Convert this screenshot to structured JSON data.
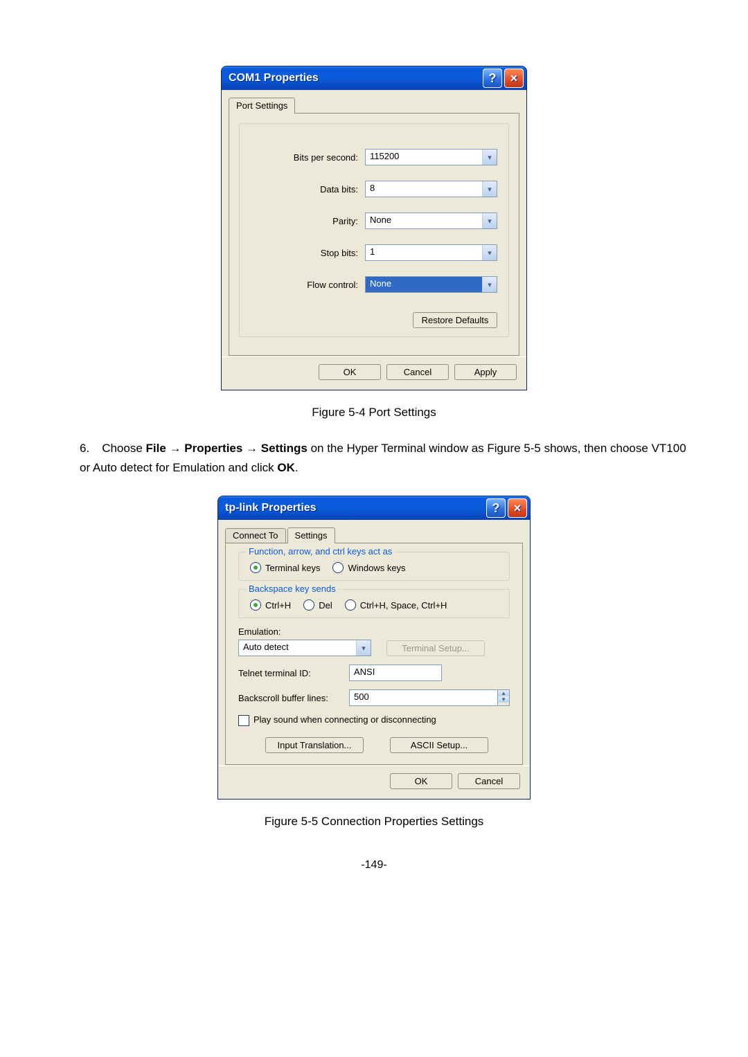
{
  "dialog1": {
    "title": "COM1 Properties",
    "tab": "Port Settings",
    "labels": {
      "bps": "Bits per second:",
      "data": "Data bits:",
      "parity": "Parity:",
      "stop": "Stop bits:",
      "flow": "Flow control:"
    },
    "values": {
      "bps": "115200",
      "data": "8",
      "parity": "None",
      "stop": "1",
      "flow": "None"
    },
    "restore": "Restore Defaults",
    "ok": "OK",
    "cancel": "Cancel",
    "apply": "Apply"
  },
  "fig1": "Figure 5-4 Port Settings",
  "body": {
    "num": "6.",
    "t1": "Choose ",
    "b1": "File → Properties → Settings",
    "t2": " on the Hyper Terminal window as Figure 5-5 shows, then choose VT100 or Auto detect for Emulation and click ",
    "b2": "OK",
    "t3": "."
  },
  "dialog2": {
    "title": "tp-link Properties",
    "tab_connect": "Connect To",
    "tab_settings": "Settings",
    "grp1": "Function, arrow, and ctrl keys act as",
    "r_terminal": "Terminal keys",
    "r_windows": "Windows keys",
    "grp2": "Backspace key sends",
    "r_ctrlh": "Ctrl+H",
    "r_del": "Del",
    "r_chsch": "Ctrl+H, Space, Ctrl+H",
    "emu_label": "Emulation:",
    "emu_value": "Auto detect",
    "term_setup": "Terminal Setup...",
    "telnet_label": "Telnet terminal ID:",
    "telnet_value": "ANSI",
    "backscroll_label": "Backscroll buffer lines:",
    "backscroll_value": "500",
    "playsound": "Play sound when connecting or disconnecting",
    "input_trans": "Input Translation...",
    "ascii_setup": "ASCII Setup...",
    "ok": "OK",
    "cancel": "Cancel"
  },
  "fig2": "Figure 5-5 Connection Properties Settings",
  "pagenum": "-149-"
}
